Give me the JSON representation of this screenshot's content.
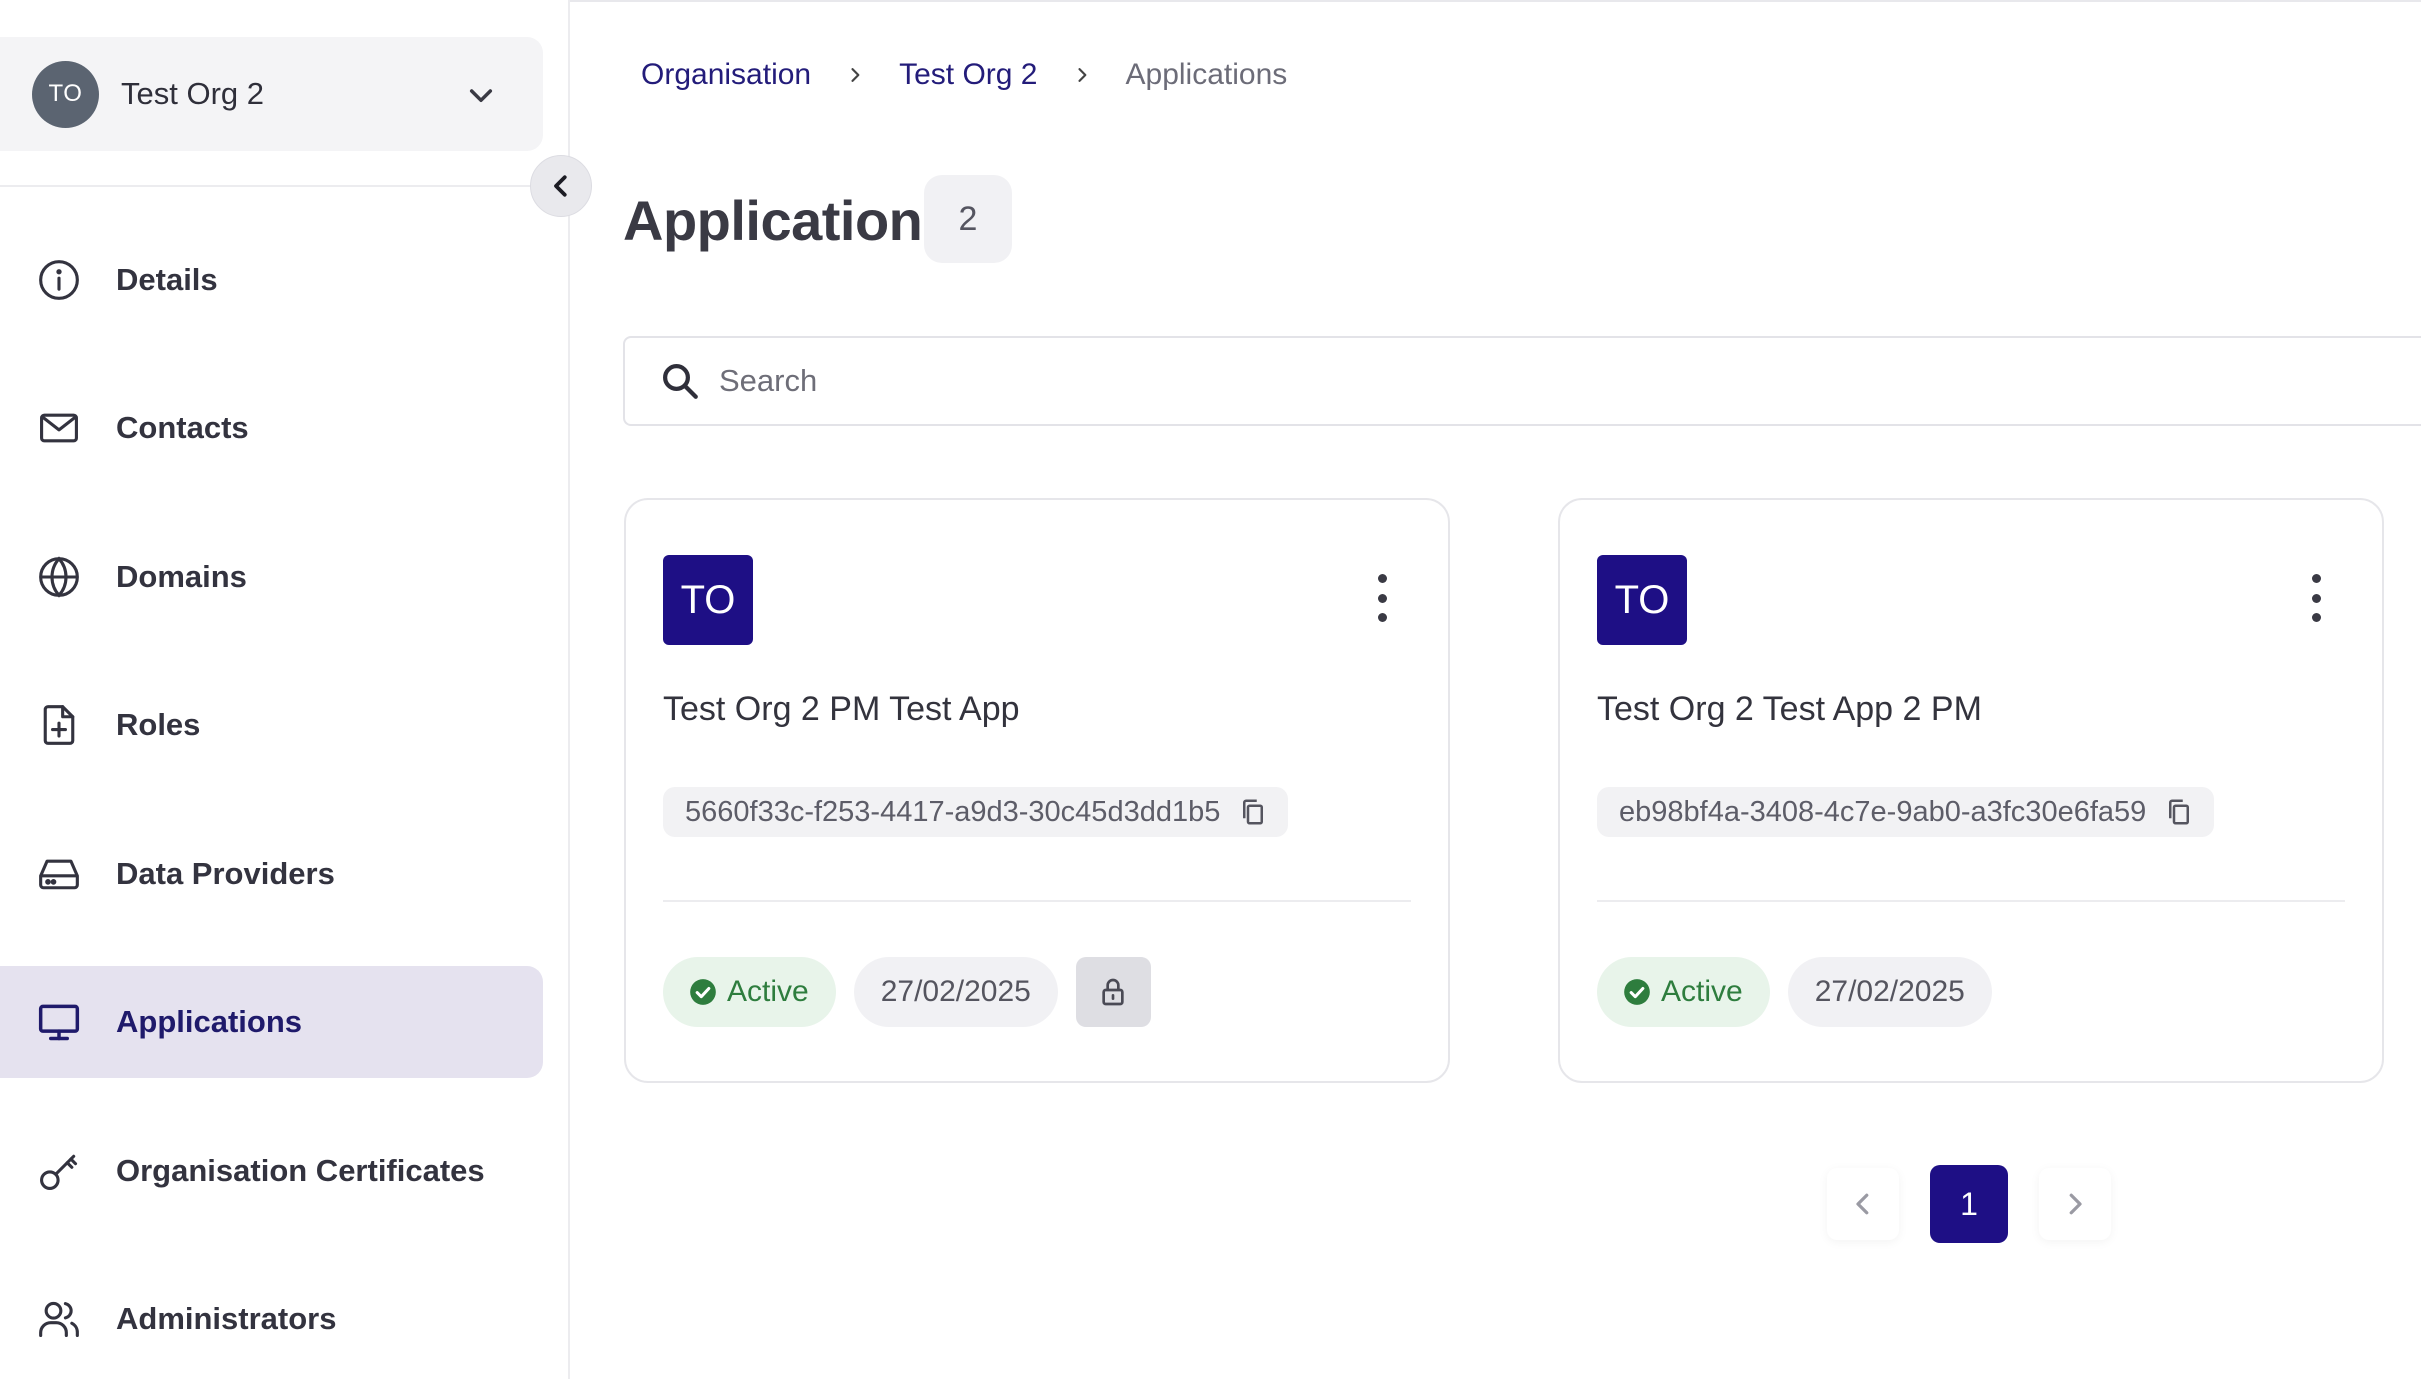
{
  "org_switcher": {
    "avatar_initials": "TO",
    "name": "Test Org 2"
  },
  "sidebar": {
    "items": [
      {
        "label": "Details",
        "icon": "info-icon"
      },
      {
        "label": "Contacts",
        "icon": "mail-icon"
      },
      {
        "label": "Domains",
        "icon": "globe-icon"
      },
      {
        "label": "Roles",
        "icon": "file-plus-icon"
      },
      {
        "label": "Data Providers",
        "icon": "hard-drive-icon"
      },
      {
        "label": "Applications",
        "icon": "monitor-icon",
        "active": true
      },
      {
        "label": "Organisation Certificates",
        "icon": "key-icon"
      },
      {
        "label": "Administrators",
        "icon": "users-icon"
      }
    ]
  },
  "breadcrumb": {
    "root": "Organisation",
    "org": "Test Org 2",
    "current": "Applications"
  },
  "page": {
    "title": "Applications",
    "count": "2"
  },
  "search": {
    "placeholder": "Search",
    "value": ""
  },
  "applications": [
    {
      "initials": "TO",
      "name": "Test Org 2 PM Test App",
      "id": "5660f33c-f253-4417-a9d3-30c45d3dd1b5",
      "status": "Active",
      "date": "27/02/2025",
      "locked": true
    },
    {
      "initials": "TO",
      "name": "Test Org 2 Test App 2 PM",
      "id": "eb98bf4a-3408-4c7e-9ab0-a3fc30e6fa59",
      "status": "Active",
      "date": "27/02/2025",
      "locked": false
    }
  ],
  "pagination": {
    "current_page": "1"
  },
  "colors": {
    "brand": "#1e0f85",
    "active_nav_bg": "#e5e2ef",
    "status_active_bg": "#e8f4ea",
    "status_active_fg": "#2e7d3e"
  }
}
